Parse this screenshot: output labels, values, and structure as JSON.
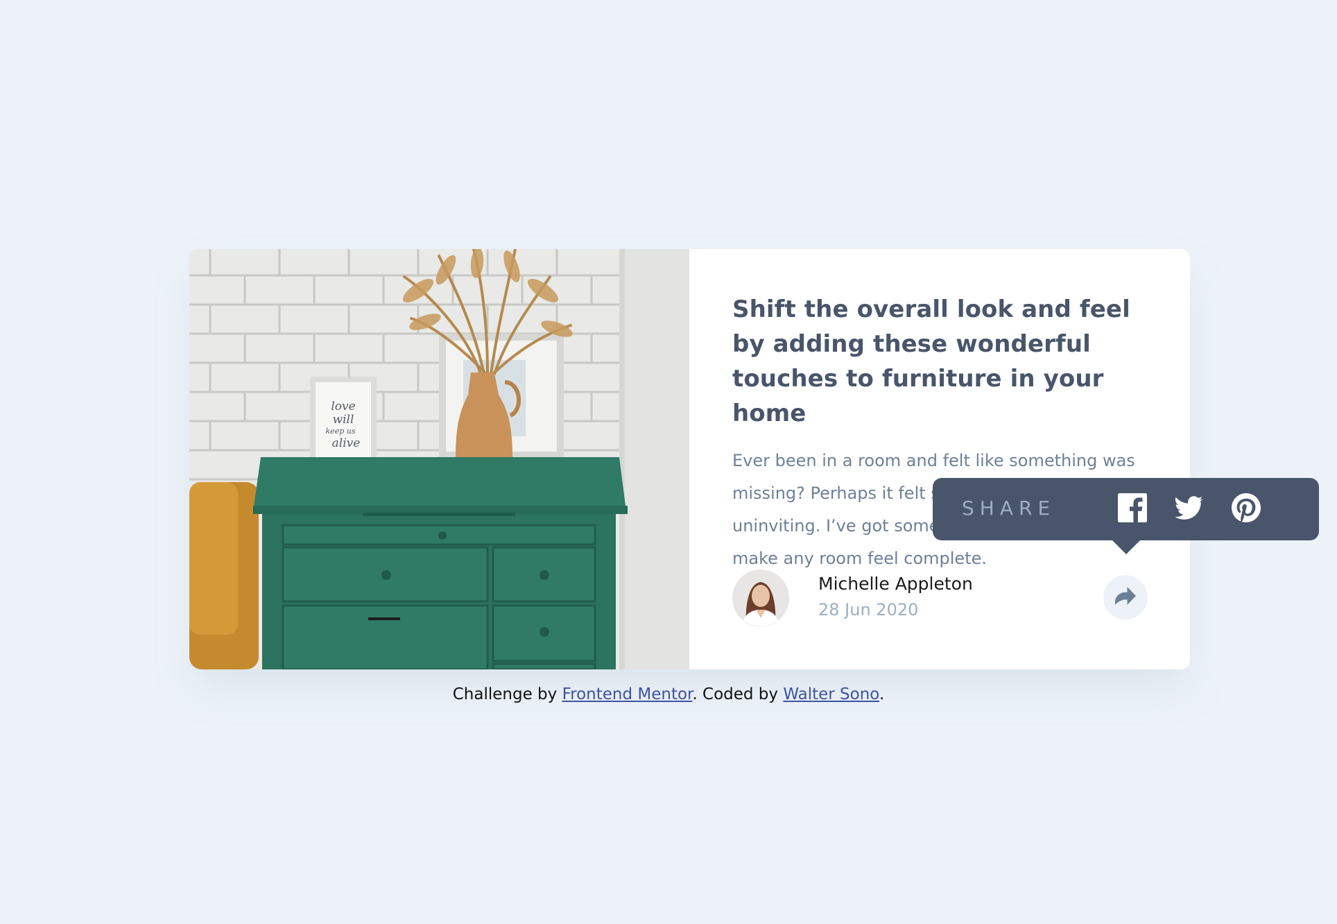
{
  "article": {
    "title": "Shift the overall look and feel by adding these wonderful touches to furniture in your home",
    "description": "Ever been in a room and felt like something was missing? Perhaps it felt slightly bare and uninviting. I’ve got some simple tips to help you make any room feel complete.",
    "image_alt": "drawers"
  },
  "author": {
    "name": "Michelle Appleton",
    "date": "28 Jun 2020"
  },
  "share": {
    "label": "SHARE",
    "icons": [
      "facebook-icon",
      "twitter-icon",
      "pinterest-icon"
    ],
    "button_icon": "share-icon"
  },
  "footer": {
    "prefix": "Challenge by ",
    "link1": "Frontend Mentor",
    "middle": ". Coded by ",
    "link2": "Walter Sono",
    "suffix": "."
  },
  "colors": {
    "background": "#ECF2F8",
    "card": "#FFFFFF",
    "title": "#48556A",
    "body_text": "#6E8098",
    "muted": "#9DAEC2",
    "tooltip": "#48556A",
    "link": "#3E52A3"
  }
}
